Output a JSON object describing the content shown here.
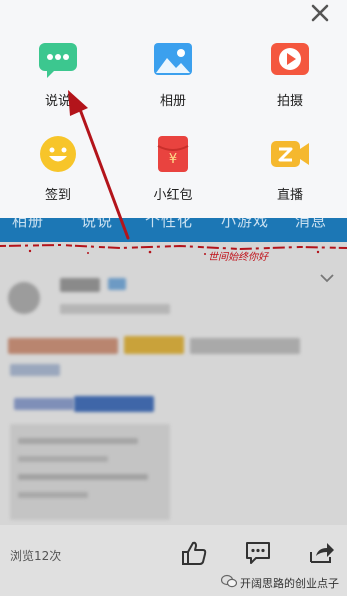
{
  "menu": {
    "items": [
      {
        "label": "说说",
        "icon": "chat-bubble-icon"
      },
      {
        "label": "相册",
        "icon": "photo-album-icon"
      },
      {
        "label": "拍摄",
        "icon": "video-record-icon"
      },
      {
        "label": "签到",
        "icon": "smiley-checkin-icon"
      },
      {
        "label": "小红包",
        "icon": "red-packet-icon"
      },
      {
        "label": "直播",
        "icon": "live-camera-icon"
      }
    ]
  },
  "tabs": [
    "相册",
    "说说",
    "个性化",
    "小游戏",
    "消息"
  ],
  "overlay_note": "世间始终你好",
  "footer": {
    "views_label": "浏览12次",
    "watermark": "开阔思路的创业点子"
  },
  "colors": {
    "menu_bg": "#f6f7f9",
    "tab_blue": "#1c77b5",
    "arrow_red": "#b3141b",
    "green": "#3cc78f",
    "blue": "#3ba0ee",
    "orange_red": "#f4573f",
    "yellow": "#f7c52a",
    "red": "#e9433f",
    "gold": "#f5b82e"
  }
}
